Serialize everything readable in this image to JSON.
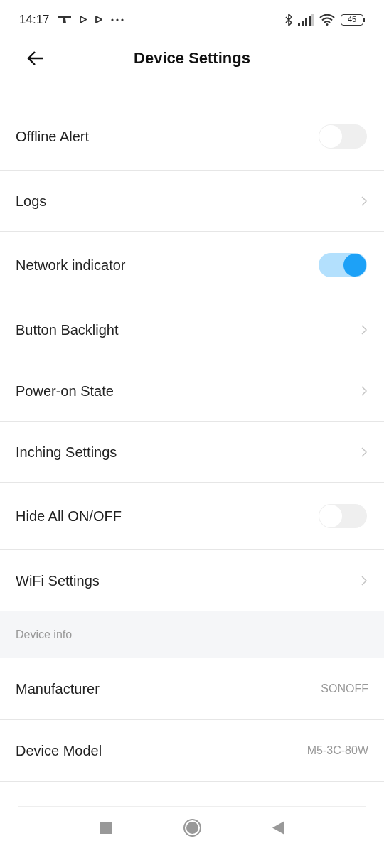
{
  "status_bar": {
    "time": "14:17",
    "battery": "45"
  },
  "header": {
    "title": "Device Settings"
  },
  "settings": [
    {
      "kind": "toggle",
      "label": "Offline Alert",
      "on": false
    },
    {
      "kind": "link",
      "label": "Logs"
    },
    {
      "kind": "toggle",
      "label": "Network indicator",
      "on": true
    },
    {
      "kind": "link",
      "label": "Button Backlight"
    },
    {
      "kind": "link",
      "label": "Power-on State"
    },
    {
      "kind": "link",
      "label": "Inching Settings"
    },
    {
      "kind": "toggle",
      "label": "Hide All ON/OFF",
      "on": false
    },
    {
      "kind": "link",
      "label": "WiFi Settings"
    }
  ],
  "device_info": {
    "heading": "Device info",
    "rows": [
      {
        "label": "Manufacturer",
        "value": "SONOFF"
      },
      {
        "label": "Device Model",
        "value": "M5-3C-80W"
      }
    ]
  }
}
